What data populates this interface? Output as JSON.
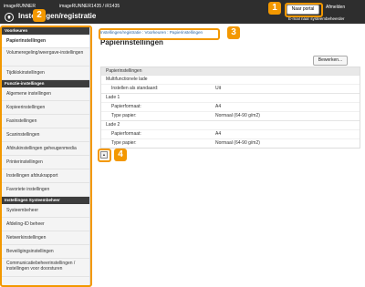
{
  "header": {
    "device_name_1": "imageRUNNER",
    "device_name_2": "imageRUNNER1435 / iR1435",
    "title": "Instellingen/registratie",
    "portal_button": "Naar portal",
    "logout": "Afmelden",
    "mail_admin": "E-mail naar systeembeheerder"
  },
  "callouts": [
    "1",
    "2",
    "3",
    "4"
  ],
  "sidebar": {
    "section1": "Voorkeuren",
    "items1": [
      "Papierinstellingen",
      "Volumeregeling/weergave-instellingen",
      "Tijdklokinstellingen"
    ],
    "section2": "Functie-instellingen",
    "items2": [
      "Algemene instellingen",
      "Kopieerinstellingen",
      "Faxinstellingen",
      "Scaninstellingen",
      "Afdrukinstellingen geheugenmedia",
      "Printerinstellingen",
      "Instellingen afdrukrapport",
      "Favoriete instellingen"
    ],
    "section3": "Instellingen Systeembeheer",
    "items3": [
      "Systeembeheer",
      "Afdeling-ID beheer",
      "Netwerkinstellingen",
      "Beveiligingsinstellingen",
      "Communicatiebeheerinstellingen / instellingen voor doorsturen"
    ]
  },
  "main": {
    "breadcrumb": "Instellingen/registratie : Voorkeuren : Papierinstellingen",
    "page_title": "Papierinstellingen",
    "edit_button": "Bewerken...",
    "panel_title": "Papierinstellingen",
    "multi_tray": "Multifunctionele lade",
    "set_default_key": "Instellen als standaard:",
    "set_default_val": "Uit",
    "lade1": "Lade 1",
    "lade2": "Lade 2",
    "paper_format_key": "Papierformaat:",
    "paper_format_val": "A4",
    "paper_type_key": "Type papier:",
    "paper_type_val": "Normaal (64-90 g/m2)",
    "to_top": "▲"
  },
  "colors": {
    "accent": "#f39800",
    "topbar": "#2e2e2e"
  }
}
